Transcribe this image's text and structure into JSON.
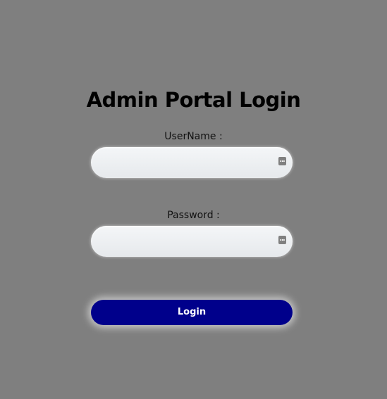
{
  "page": {
    "title": "Admin Portal Login"
  },
  "form": {
    "username_label": "UserName :",
    "username_value": "",
    "password_label": "Password :",
    "password_value": "",
    "login_label": "Login"
  },
  "icons": {
    "username_field_icon": "password-manager-key-icon",
    "password_field_icon": "password-manager-key-icon"
  },
  "colors": {
    "background": "#7f7f7f",
    "button": "#00008b",
    "button_text": "#ffffff",
    "input_background": "#eceff1"
  }
}
